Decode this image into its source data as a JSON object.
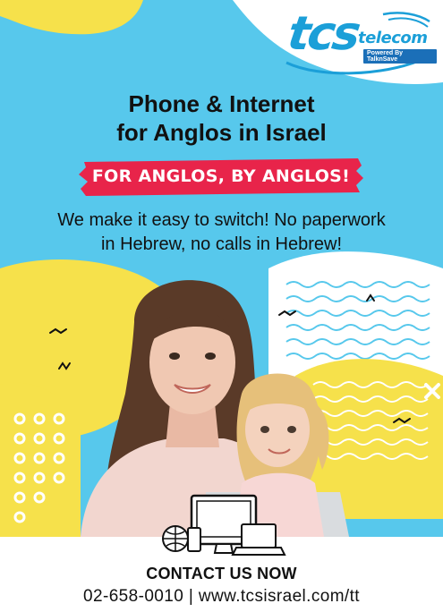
{
  "brand": {
    "logo_text": "tcs",
    "logo_sub": "telecom",
    "tagline": "Powered By TalknSave",
    "primary_color": "#1b9fd8",
    "accent_color": "#e8244a"
  },
  "headline": {
    "line1": "Phone & Internet",
    "line2": "for Anglos in Israel"
  },
  "ribbon": {
    "text": "FOR ANGLOS, BY ANGLOS!"
  },
  "subtext": {
    "line1": "We make it easy to switch! No paperwork",
    "line2": "in Hebrew, no calls in Hebrew!"
  },
  "illustration": {
    "devices_icon": "devices-globe-icon"
  },
  "footer": {
    "cta": "CONTACT US NOW",
    "contact": "02-658-0010 | www.tcsisrael.com/tt"
  },
  "colors": {
    "sky": "#57c8ec",
    "yellow": "#f6e14b",
    "white": "#ffffff"
  }
}
